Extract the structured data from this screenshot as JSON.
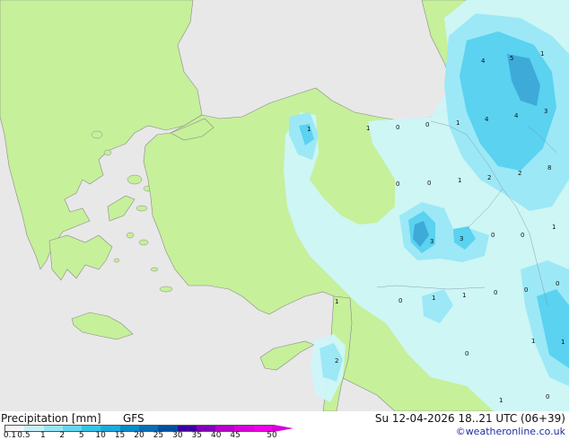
{
  "footer": {
    "title": "Precipitation [mm]",
    "model": "GFS",
    "validity": "Su 12-04-2026 18..21 UTC (06+39)",
    "credit": "©weatheronline.co.uk"
  },
  "legend": {
    "tick_labels": [
      "0.1",
      "0.5",
      "1",
      "2",
      "5",
      "10",
      "15",
      "20",
      "25",
      "30",
      "35",
      "40",
      "45",
      "50"
    ],
    "colors": [
      "#f5f5f5",
      "#c8f0f8",
      "#96e6f5",
      "#64d7f0",
      "#37c3e6",
      "#1eaadc",
      "#0a8cc8",
      "#0a6eb4",
      "#0050a0",
      "#3c00a0",
      "#8200b4",
      "#b400c8",
      "#d800d8",
      "#f000e6"
    ]
  },
  "map": {
    "land_color": "#c6f09a",
    "sea_color": "#e8e8e8",
    "precip_colors": [
      "#cef6fa",
      "#9ce8f6",
      "#5ad2f0",
      "#3eaad8"
    ],
    "value_labels": [
      "1",
      "4",
      "5",
      "1",
      "1",
      "4",
      "4",
      "3",
      "1",
      "0",
      "0",
      "0",
      "2",
      "2",
      "8",
      "0",
      "0",
      "1",
      "3",
      "3",
      "0",
      "1",
      "0",
      "1",
      "1",
      "0",
      "0",
      "0",
      "1",
      "1",
      "0",
      "2",
      "1",
      "0",
      "1"
    ]
  }
}
